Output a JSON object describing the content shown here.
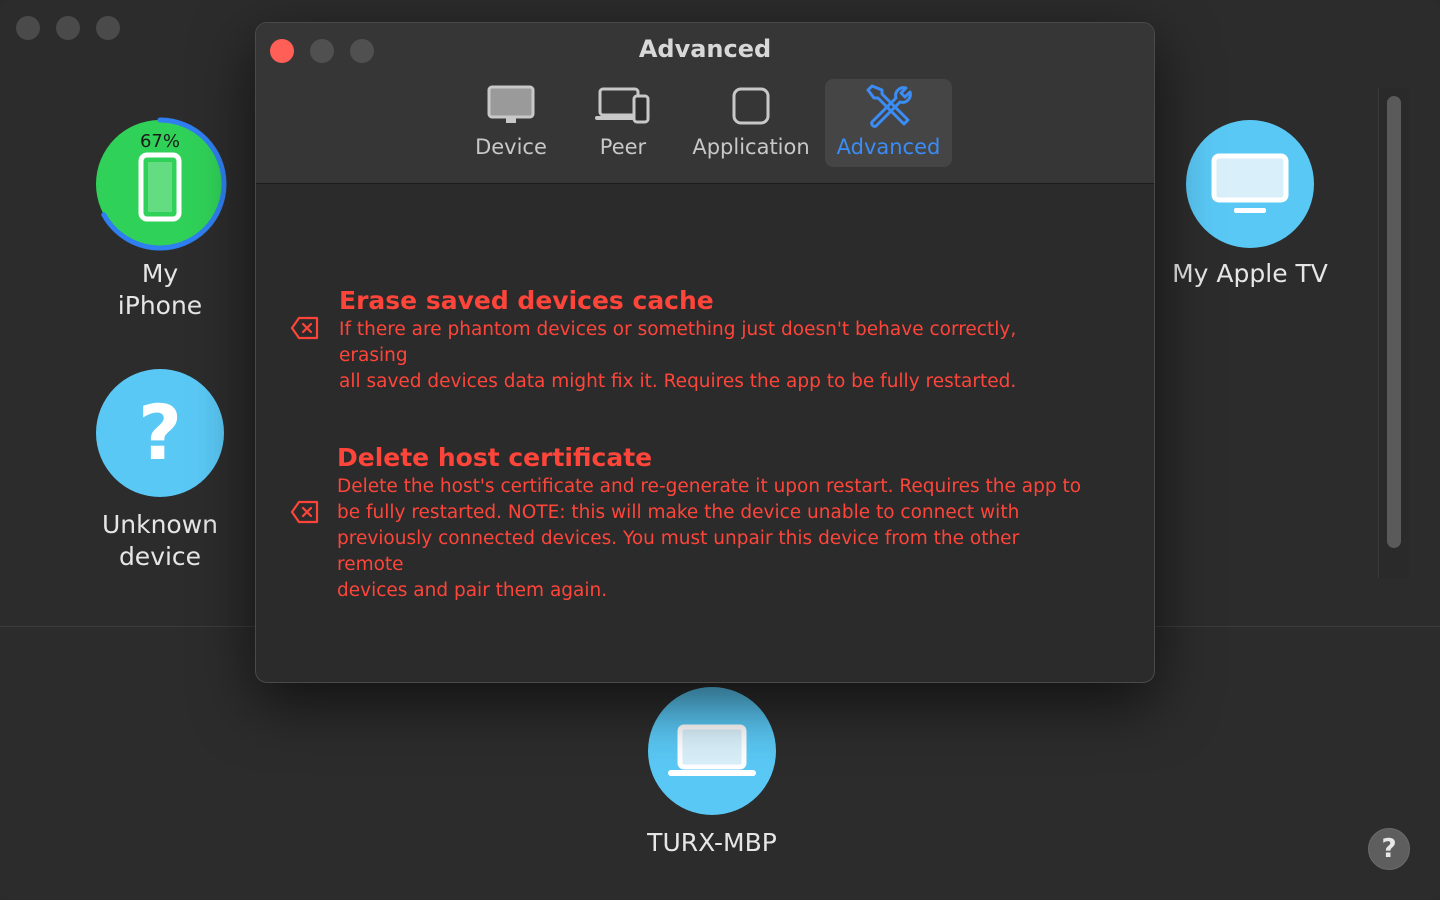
{
  "devices": {
    "iphone": {
      "name": "My iPhone",
      "battery": "67%",
      "battery_fraction": 0.67,
      "icon": "iphone-icon"
    },
    "unknown": {
      "name_line1": "Unknown",
      "name_line2": "device",
      "icon": "question-mark-icon"
    },
    "apple_tv": {
      "name": "My Apple TV",
      "icon": "tv-icon"
    },
    "host": {
      "name": "TURX-MBP",
      "icon": "laptop-icon"
    }
  },
  "dialog": {
    "title": "Advanced",
    "tabs": [
      {
        "label": "Device",
        "icon": "monitor-icon",
        "active": false
      },
      {
        "label": "Peer",
        "icon": "devices-icon",
        "active": false
      },
      {
        "label": "Application",
        "icon": "app-square-icon",
        "active": false
      },
      {
        "label": "Advanced",
        "icon": "tools-icon",
        "active": true
      }
    ],
    "options": [
      {
        "title": "Erase saved devices cache",
        "desc_line1": "If there are phantom devices or something just doesn't behave correctly, erasing",
        "desc_line2": "all saved devices data might fix it. Requires the app to be fully restarted.",
        "icon": "erase-icon"
      },
      {
        "title": "Delete host certificate",
        "desc_line1": "Delete the host's certificate and re-generate it upon restart. Requires the app to",
        "desc_line2": "be fully restarted. NOTE: this will make the device unable to connect with",
        "desc_line3": "previously connected devices. You must unpair this device from the other remote",
        "desc_line4": "devices and pair them again.",
        "icon": "erase-icon"
      }
    ]
  },
  "help": {
    "label": "?"
  },
  "colors": {
    "accent_blue": "#3b8cf5",
    "danger_red": "#ff453a",
    "device_blue": "#5ac8f5",
    "battery_green": "#30d158"
  }
}
